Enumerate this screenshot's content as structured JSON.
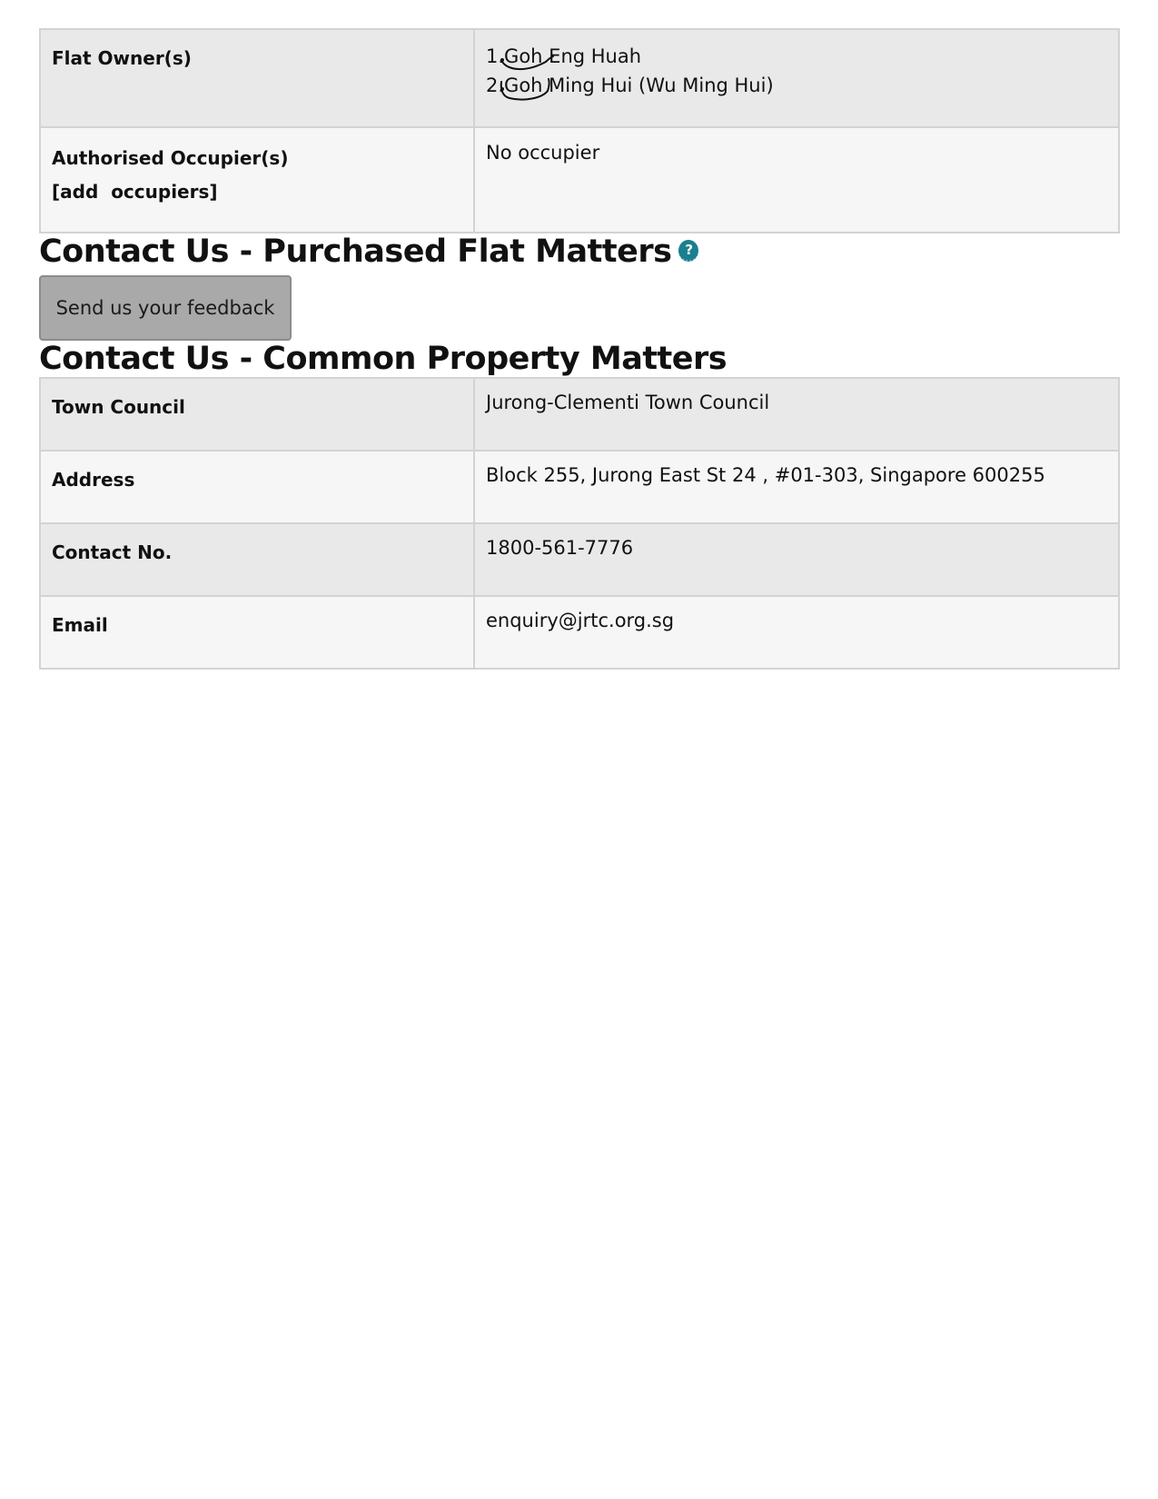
{
  "flat_info": {
    "owners_label": "Flat Owner(s)",
    "owners": [
      {
        "prefix": "1.",
        "surname": "Goh",
        "rest": "Eng Huah"
      },
      {
        "prefix": "2.",
        "surname": "Goh",
        "rest": "Ming Hui (Wu Ming Hui)"
      }
    ],
    "occupiers_label": "Authorised Occupier(s)",
    "add_occupiers_link": "[add  occupiers]",
    "occupiers_value": "No occupier"
  },
  "purchased_flat_section": {
    "title": "Contact Us - Purchased Flat Matters",
    "help_icon": "question-circle-icon",
    "help_glyph": "?",
    "feedback_button": "Send us your feedback"
  },
  "common_property_section": {
    "title": "Contact Us - Common Property Matters",
    "rows": [
      {
        "label": "Town Council",
        "value": "Jurong-Clementi Town Council"
      },
      {
        "label": "Address",
        "value": "Block 255, Jurong East St 24 , #01-303, Singapore 600255"
      },
      {
        "label": "Contact No.",
        "value": "1800-561-7776"
      },
      {
        "label": "Email",
        "value": "enquiry@jrtc.org.sg"
      }
    ]
  },
  "colors": {
    "row_dark": "#e9e9e9",
    "row_light": "#f6f6f6",
    "border": "#d3d3d3",
    "help_icon": "#1a7f8e",
    "button_bg": "#a9a9a9"
  }
}
